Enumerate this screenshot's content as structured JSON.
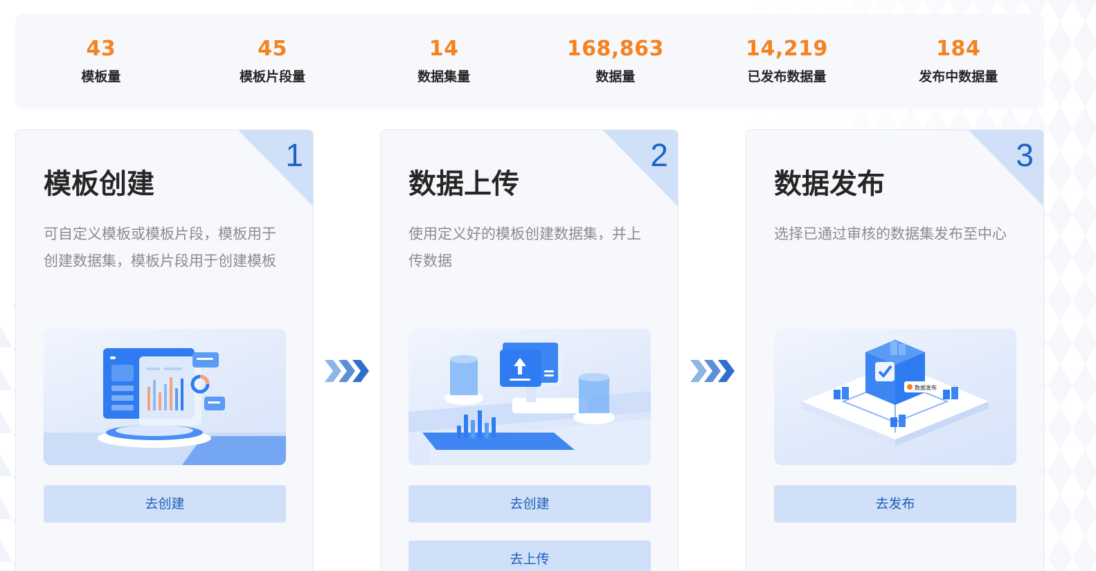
{
  "stats": [
    {
      "value": "43",
      "label": "模板量"
    },
    {
      "value": "45",
      "label": "模板片段量"
    },
    {
      "value": "14",
      "label": "数据集量"
    },
    {
      "value": "168,863",
      "label": "数据量"
    },
    {
      "value": "14,219",
      "label": "已发布数据量"
    },
    {
      "value": "184",
      "label": "发布中数据量"
    }
  ],
  "steps": [
    {
      "number": "1",
      "title": "模板创建",
      "description": "可自定义模板或模板片段，模板用于创建数据集，模板片段用于创建模板",
      "illustration_icon": "dashboard-charts-illustration",
      "buttons": [
        "去创建"
      ]
    },
    {
      "number": "2",
      "title": "数据上传",
      "description": "使用定义好的模板创建数据集，并上传数据",
      "illustration_icon": "upload-monitor-illustration",
      "buttons": [
        "去创建",
        "去上传"
      ]
    },
    {
      "number": "3",
      "title": "数据发布",
      "description": "选择已通过审核的数据集发布至中心",
      "illustration_icon": "data-publish-hub-illustration",
      "illustration_label": "数据发布",
      "buttons": [
        "去发布"
      ]
    }
  ],
  "colors": {
    "stat_value": "#f5821f",
    "accent_blue": "#1c63c7",
    "button_bg": "#cfe0f8",
    "card_bg": "#f6f8fb"
  }
}
